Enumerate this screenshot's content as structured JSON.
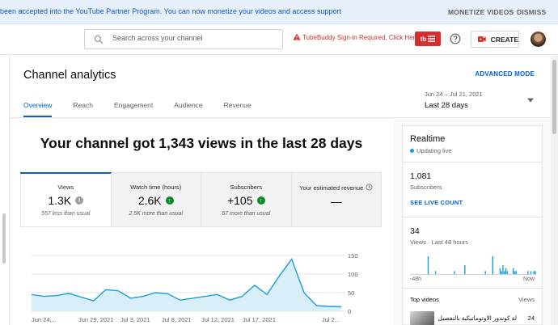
{
  "banner": {
    "text": "been accepted into the YouTube Partner Program. You can now monetize your videos and access support",
    "monetize_label": "MONETIZE VIDEOS",
    "dismiss_label": "DISMISS"
  },
  "header": {
    "search_placeholder": "Search across your channel",
    "tubebuddy_warning": "TubeBuddy Sign-in Required, Click Here",
    "tubebuddy_icon": "tubebuddy-logo",
    "create_label": "CREATE"
  },
  "page": {
    "title": "Channel analytics",
    "advanced_label": "ADVANCED MODE",
    "tabs": [
      {
        "label": "Overview",
        "active": true
      },
      {
        "label": "Reach",
        "active": false
      },
      {
        "label": "Engagement",
        "active": false
      },
      {
        "label": "Audience",
        "active": false
      },
      {
        "label": "Revenue",
        "active": false
      }
    ],
    "date_range": "Jun 24 – Jul 21, 2021",
    "date_preset": "Last 28 days"
  },
  "summary": {
    "headline": "Your channel got 1,343 views in the last 28 days",
    "metrics": [
      {
        "label": "Views",
        "value": "1.3K",
        "badge": "!",
        "badge_color": "#9e9e9e",
        "note": "557 less than usual"
      },
      {
        "label": "Watch time (hours)",
        "value": "2.6K",
        "badge": "↑",
        "badge_color": "#0a8a29",
        "note": "2.5K more than usual"
      },
      {
        "label": "Subscribers",
        "value": "+105",
        "badge": "↑",
        "badge_color": "#0a8a29",
        "note": "67 more than usual"
      },
      {
        "label": "Your estimated revenue",
        "value": "—",
        "badge": "",
        "badge_color": "",
        "note": ""
      }
    ]
  },
  "chart_data": {
    "type": "area",
    "series": [
      {
        "values": [
          45,
          40,
          42,
          48,
          38,
          28,
          58,
          55,
          35,
          40,
          50,
          47,
          30,
          35,
          40,
          45,
          30,
          40,
          70,
          45,
          95,
          140,
          50,
          15,
          13,
          12
        ]
      }
    ],
    "x_tick_labels": [
      "Jun 24,...",
      "Jun 29, 2021",
      "Jul 3, 2021",
      "Jul 8, 2021",
      "Jul 12, 2021",
      "Jul 17, 2021",
      "Jul 2..."
    ],
    "y_tick_labels": [
      "150",
      "100",
      "50",
      "0"
    ],
    "ylim": [
      0,
      150
    ],
    "color": "#1a9fd6",
    "fill_color": "#d8eef8",
    "grid": true
  },
  "realtime": {
    "title": "Realtime",
    "status": "Updating live",
    "subscriber_count": "1,081",
    "subscriber_label": "Subscribers",
    "live_count_link": "SEE LIVE COUNT",
    "views_count": "34",
    "views_label": "Views · Last 48 hours",
    "hourly_views": [
      0,
      0,
      0,
      0,
      0,
      0,
      0,
      0,
      0,
      0,
      0,
      0,
      6,
      0,
      0,
      0,
      0,
      1,
      0,
      0,
      0,
      0,
      0,
      0,
      0,
      0,
      0,
      0,
      0,
      0,
      1,
      0,
      0,
      0,
      0,
      0,
      0,
      3,
      0,
      0,
      0,
      0,
      0,
      0,
      0,
      0,
      0,
      0,
      0,
      0,
      0,
      1,
      0,
      0,
      0,
      0,
      6,
      0,
      0,
      0,
      0,
      2,
      1,
      3,
      1,
      2,
      1,
      0,
      0,
      0,
      2,
      1,
      1,
      0,
      0,
      0,
      0,
      0,
      0,
      0,
      1,
      0,
      1,
      0,
      1,
      1
    ],
    "axis_left": "-48h",
    "axis_right": "Now",
    "top_videos_label": "Top videos",
    "views_col_label": "Views",
    "top_video_title": "لة كوندور الاوتوماتيكية بالتفصيل",
    "top_video_views": "24"
  }
}
